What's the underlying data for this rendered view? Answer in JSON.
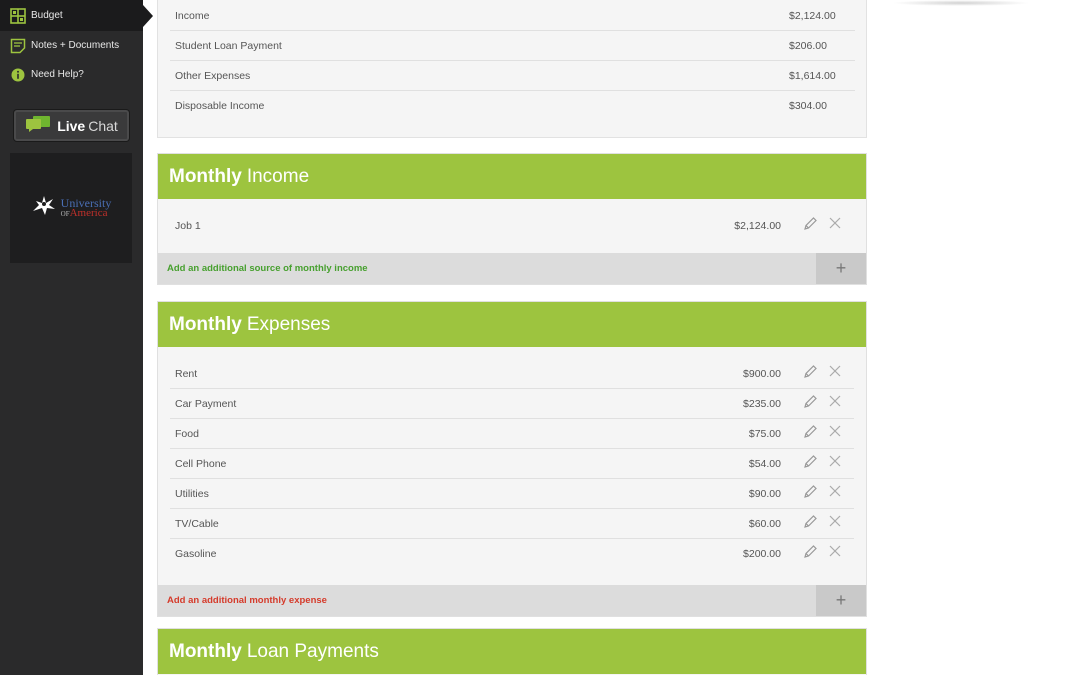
{
  "sidebar": {
    "nav": [
      {
        "label": "Budget",
        "icon": "budget-grid-icon"
      },
      {
        "label": "Notes + Documents",
        "icon": "notes-icon"
      },
      {
        "label": "Need Help?",
        "icon": "info-icon"
      }
    ],
    "live_chat": {
      "bold": "Live",
      "light": "Chat",
      "icon": "chat-bubbles-icon"
    },
    "logo": {
      "line1": "University",
      "line2_small": "OF",
      "line2": "America"
    }
  },
  "summary": {
    "rows": [
      {
        "label": "Income",
        "value": "$2,124.00"
      },
      {
        "label": "Student Loan Payment",
        "value": "$206.00"
      },
      {
        "label": "Other Expenses",
        "value": "$1,614.00"
      },
      {
        "label": "Disposable Income",
        "value": "$304.00"
      }
    ]
  },
  "income": {
    "title_bold": "Monthly",
    "title_light": "Income",
    "items": [
      {
        "label": "Job 1",
        "amount": "$2,124.00"
      }
    ],
    "add_label": "Add an additional source of monthly income",
    "add_symbol": "+"
  },
  "expenses": {
    "title_bold": "Monthly",
    "title_light": "Expenses",
    "items": [
      {
        "label": "Rent",
        "amount": "$900.00"
      },
      {
        "label": "Car Payment",
        "amount": "$235.00"
      },
      {
        "label": "Food",
        "amount": "$75.00"
      },
      {
        "label": "Cell Phone",
        "amount": "$54.00"
      },
      {
        "label": "Utilities",
        "amount": "$90.00"
      },
      {
        "label": "TV/Cable",
        "amount": "$60.00"
      },
      {
        "label": "Gasoline",
        "amount": "$200.00"
      }
    ],
    "add_label": "Add an additional monthly expense",
    "add_symbol": "+"
  },
  "loans": {
    "title_bold": "Monthly",
    "title_light": "Loan Payments"
  },
  "colors": {
    "accent_green": "#9dc43f",
    "add_income_text": "#47a02f",
    "add_expense_text": "#d53b2b",
    "sidebar_bg": "#2a2a2b"
  }
}
